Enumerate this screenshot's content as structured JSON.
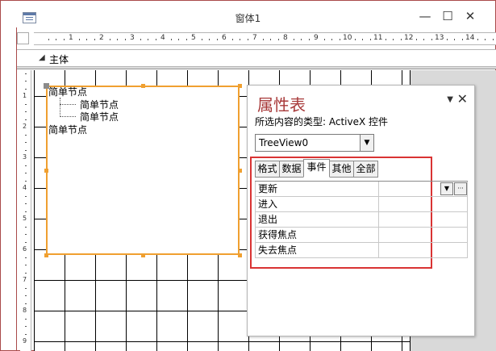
{
  "window": {
    "title": "窗体1",
    "minimize_label": "—",
    "maximize_label": "☐",
    "close_label": "✕"
  },
  "ruler": {
    "h_numbers": [
      "1",
      "2",
      "3",
      "4",
      "5",
      "6",
      "7",
      "8",
      "9",
      "10",
      "11",
      "12",
      "13",
      "14"
    ],
    "v_numbers": [
      "1",
      "2",
      "3",
      "4",
      "5",
      "6",
      "7",
      "8",
      "9"
    ]
  },
  "section": {
    "arrow": "◢",
    "label": "主体"
  },
  "tree": {
    "nodes": [
      {
        "label": "简单节点",
        "level": 0
      },
      {
        "label": "简单节点",
        "level": 1
      },
      {
        "label": "简单节点",
        "level": 1
      },
      {
        "label": "简单节点",
        "level": 0
      }
    ]
  },
  "property_sheet": {
    "title": "属性表",
    "menu_arrow": "▼",
    "close_label": "✕",
    "selection_type": "所选内容的类型:  ActiveX 控件",
    "object_combo_value": "TreeView0",
    "combo_arrow": "▼",
    "tabs": [
      {
        "label": "格式",
        "active": false
      },
      {
        "label": "数据",
        "active": false
      },
      {
        "label": "事件",
        "active": true
      },
      {
        "label": "其他",
        "active": false
      },
      {
        "label": "全部",
        "active": false
      }
    ],
    "properties": [
      {
        "label": "更新",
        "value": ""
      },
      {
        "label": "进入",
        "value": ""
      },
      {
        "label": "退出",
        "value": ""
      },
      {
        "label": "获得焦点",
        "value": ""
      },
      {
        "label": "失去焦点",
        "value": ""
      }
    ],
    "row_dropdown_arrow": "▼",
    "row_builder_label": "···"
  },
  "colors": {
    "accent_title": "#a83a3a",
    "selection_border": "#f0a030",
    "highlight_box": "#d93333"
  }
}
